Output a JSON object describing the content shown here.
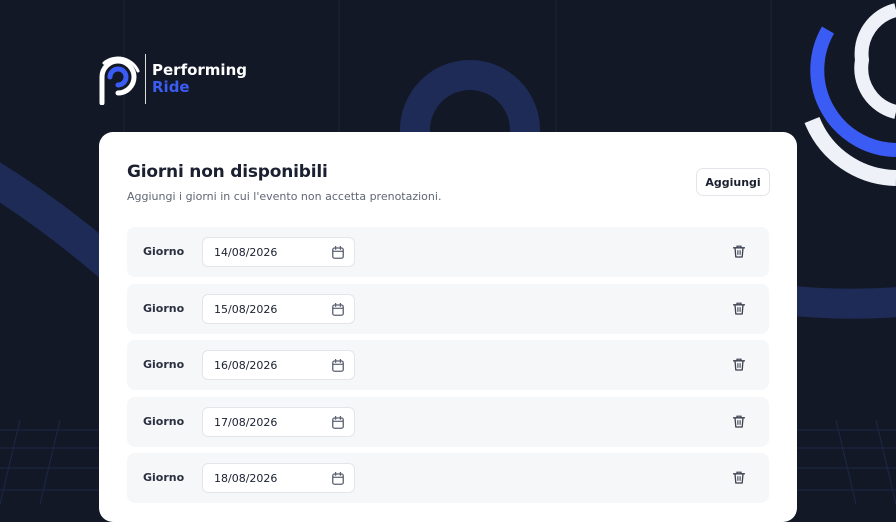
{
  "brand": {
    "name_line1": "Performing",
    "name_line2": "Ride",
    "logo_icon": "performing-ride-logo",
    "accent_color": "#3B5BF5"
  },
  "card": {
    "title": "Giorni non disponibili",
    "subtitle": "Aggiungi i giorni in cui l'evento non accetta prenotazioni.",
    "add_label": "Aggiungi"
  },
  "rows": [
    {
      "label": "Giorno",
      "value": "14/08/2026"
    },
    {
      "label": "Giorno",
      "value": "15/08/2026"
    },
    {
      "label": "Giorno",
      "value": "16/08/2026"
    },
    {
      "label": "Giorno",
      "value": "17/08/2026"
    },
    {
      "label": "Giorno",
      "value": "18/08/2026"
    }
  ],
  "icons": {
    "date_picker": "calendar-icon",
    "remove": "trash-icon"
  },
  "colors": {
    "background": "#121826",
    "card": "#ffffff",
    "row": "#f6f7f9",
    "text": "#1b2030"
  }
}
